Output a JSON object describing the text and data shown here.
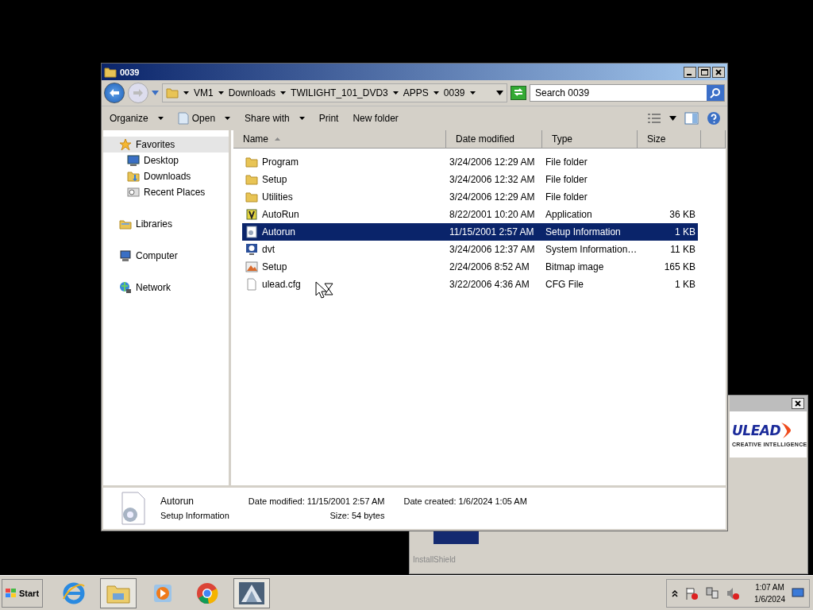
{
  "explorer": {
    "title": "0039",
    "breadcrumb": [
      "VM1",
      "Downloads",
      "TWILIGHT_101_DVD3",
      "APPS",
      "0039"
    ],
    "search": {
      "placeholder": "Search 0039"
    },
    "toolbar": [
      {
        "label": "Organize",
        "dropdown": true,
        "icon": false
      },
      {
        "label": "Open",
        "dropdown": true,
        "icon": true
      },
      {
        "label": "Share with",
        "dropdown": true,
        "icon": false
      },
      {
        "label": "Print",
        "dropdown": false,
        "icon": false
      },
      {
        "label": "New folder",
        "dropdown": false,
        "icon": false
      }
    ],
    "nav_pane": [
      {
        "label": "Favorites",
        "kind": "star",
        "selected": true,
        "children": [
          {
            "label": "Desktop",
            "kind": "desktop"
          },
          {
            "label": "Downloads",
            "kind": "downloads"
          },
          {
            "label": "Recent Places",
            "kind": "recent"
          }
        ]
      },
      {
        "label": "Libraries",
        "kind": "library",
        "selected": false
      },
      {
        "label": "Computer",
        "kind": "computer",
        "selected": false
      },
      {
        "label": "Network",
        "kind": "network",
        "selected": false
      }
    ],
    "columns": [
      "Name",
      "Date modified",
      "Type",
      "Size"
    ],
    "rows": [
      {
        "name": "Program",
        "date": "3/24/2006 12:29 AM",
        "type": "File folder",
        "size": "",
        "kind": "folder",
        "selected": false
      },
      {
        "name": "Setup",
        "date": "3/24/2006 12:32 AM",
        "type": "File folder",
        "size": "",
        "kind": "folder",
        "selected": false
      },
      {
        "name": "Utilities",
        "date": "3/24/2006 12:29 AM",
        "type": "File folder",
        "size": "",
        "kind": "folder",
        "selected": false
      },
      {
        "name": "AutoRun",
        "date": "8/22/2001 10:20 AM",
        "type": "Application",
        "size": "36 KB",
        "kind": "app",
        "selected": false
      },
      {
        "name": "Autorun",
        "date": "11/15/2001 2:57 AM",
        "type": "Setup Information",
        "size": "1 KB",
        "kind": "setup",
        "selected": true
      },
      {
        "name": "dvt",
        "date": "3/24/2006 12:37 AM",
        "type": "System Information…",
        "size": "11 KB",
        "kind": "sysinfo",
        "selected": false
      },
      {
        "name": "Setup",
        "date": "2/24/2006 8:52 AM",
        "type": "Bitmap image",
        "size": "165 KB",
        "kind": "bitmap",
        "selected": false
      },
      {
        "name": "ulead.cfg",
        "date": "3/22/2006 4:36 AM",
        "type": "CFG File",
        "size": "1 KB",
        "kind": "file",
        "selected": false
      }
    ],
    "details": {
      "name": "Autorun",
      "type": "Setup Information",
      "fields": [
        {
          "label": "Date modified:",
          "value": "11/15/2001 2:57 AM"
        },
        {
          "label": "Date created:",
          "value": "1/6/2024 1:05 AM"
        },
        {
          "label": "Size:",
          "value": "54 bytes"
        }
      ]
    }
  },
  "installer": {
    "brand": "ULEAD",
    "tagline": "CREATIVE INTELLIGENCE",
    "footer": "InstallShield"
  },
  "taskbar": {
    "start": "Start",
    "apps": [
      {
        "kind": "ie",
        "active": false
      },
      {
        "kind": "explorer",
        "active": true
      },
      {
        "kind": "media",
        "active": false
      },
      {
        "kind": "chrome",
        "active": false
      },
      {
        "kind": "installer",
        "active": true
      }
    ],
    "time": "1:07 AM",
    "date": "1/6/2024"
  }
}
